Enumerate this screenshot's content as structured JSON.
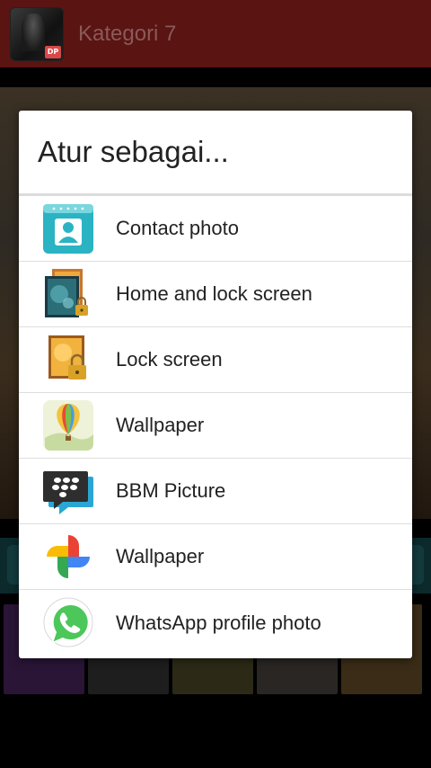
{
  "app": {
    "title": "Kategori 7",
    "logo_badge": "DP",
    "bar_color": "#5a1412"
  },
  "dialog": {
    "title": "Atur sebagai...",
    "options": [
      {
        "label": "Contact photo",
        "icon": "contact-photo-icon"
      },
      {
        "label": "Home and lock screen",
        "icon": "home-lock-screen-icon"
      },
      {
        "label": "Lock screen",
        "icon": "lock-screen-icon"
      },
      {
        "label": "Wallpaper",
        "icon": "wallpaper-balloon-icon"
      },
      {
        "label": "BBM Picture",
        "icon": "bbm-icon"
      },
      {
        "label": "Wallpaper",
        "icon": "google-photos-icon"
      },
      {
        "label": "WhatsApp profile photo",
        "icon": "whatsapp-icon"
      }
    ]
  }
}
